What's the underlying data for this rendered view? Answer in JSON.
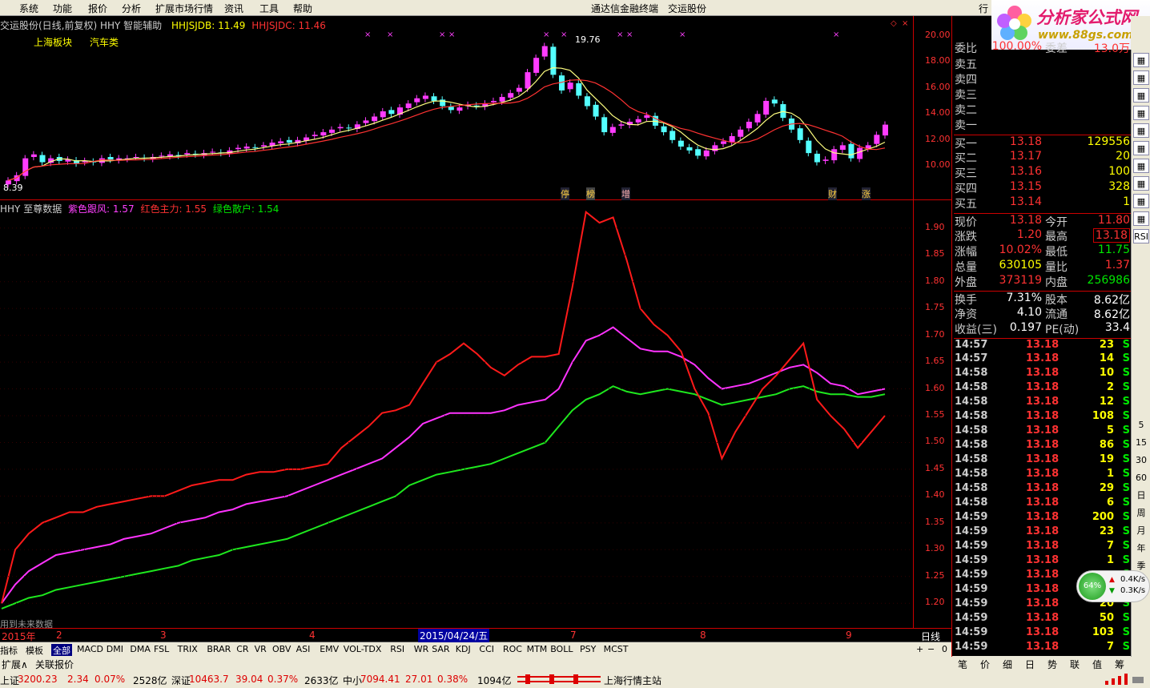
{
  "menu": {
    "items": [
      "系统",
      "功能",
      "报价",
      "分析",
      "扩展市场行情",
      "资讯",
      "工具",
      "帮助"
    ],
    "center1": "通达信金融终端",
    "center2": "交运股份",
    "right_stub": "行"
  },
  "logo": {
    "line1": "分析家公式网",
    "line2": "www.88gs.com"
  },
  "kline": {
    "header_name": "交运股份(日线,前复权) HHY 智能辅助",
    "hhsjdb": "HHJSJDB: 11.49",
    "hhsjdc": "HHJSJDC: 11.46",
    "tag1": "上海板块",
    "tag2": "汽车类",
    "high_label": "19.76",
    "low_label": "8.39",
    "markers": [
      "停",
      "榜",
      "增",
      "财",
      "涨"
    ],
    "yaxis": [
      "20.00",
      "18.00",
      "16.00",
      "14.00",
      "12.00",
      "10.00"
    ],
    "candles": [
      8.9,
      9.3,
      10.6,
      10.9,
      10.3,
      10.6,
      10.4,
      10.5,
      10.2,
      10.4,
      10.3,
      10.6,
      10.5,
      10.6,
      10.6,
      10.7,
      10.6,
      10.7,
      10.8,
      10.9,
      10.8,
      11.0,
      10.9,
      11.0,
      11.1,
      11.0,
      11.2,
      11.4,
      11.5,
      11.4,
      11.6,
      11.8,
      11.9,
      11.8,
      12.0,
      12.2,
      12.4,
      12.6,
      12.8,
      13.0,
      12.9,
      13.2,
      13.5,
      13.8,
      14.2,
      14.0,
      14.5,
      14.8,
      15.2,
      15.4,
      15.0,
      14.6,
      14.3,
      14.5,
      14.7,
      14.6,
      14.8,
      15.0,
      15.3,
      15.6,
      16.0,
      17.2,
      18.3,
      19.2,
      17.0,
      15.8,
      16.4,
      15.4,
      14.6,
      13.8,
      12.6,
      13.0,
      13.2,
      13.4,
      13.6,
      13.9,
      13.1,
      12.6,
      12.0,
      11.5,
      11.2,
      10.8,
      11.2,
      11.6,
      11.9,
      12.3,
      12.8,
      13.4,
      14.0,
      15.0,
      14.8,
      13.7,
      12.8,
      12.0,
      11.0,
      10.3,
      10.5,
      11.3,
      11.6,
      10.6,
      11.4,
      11.6,
      12.4,
      13.18
    ]
  },
  "indicator": {
    "title": "HHY 至尊数据",
    "s1": "紫色跟风: 1.57",
    "s2": "红色主力: 1.55",
    "s3": "绿色散户: 1.54",
    "note": "用到未来数据",
    "yaxis": [
      "1.90",
      "1.85",
      "1.80",
      "1.75",
      "1.70",
      "1.65",
      "1.60",
      "1.55",
      "1.50",
      "1.45",
      "1.40",
      "1.35",
      "1.30",
      "1.25",
      "1.20"
    ],
    "red": [
      1.2,
      1.3,
      1.33,
      1.35,
      1.36,
      1.37,
      1.37,
      1.38,
      1.385,
      1.39,
      1.395,
      1.4,
      1.4,
      1.41,
      1.42,
      1.425,
      1.43,
      1.43,
      1.44,
      1.445,
      1.445,
      1.45,
      1.45,
      1.455,
      1.46,
      1.49,
      1.51,
      1.53,
      1.555,
      1.56,
      1.57,
      1.61,
      1.65,
      1.665,
      1.685,
      1.665,
      1.64,
      1.625,
      1.645,
      1.66,
      1.66,
      1.665,
      1.79,
      1.93,
      1.91,
      1.92,
      1.84,
      1.75,
      1.72,
      1.7,
      1.67,
      1.6,
      1.555,
      1.47,
      1.52,
      1.56,
      1.6,
      1.625,
      1.655,
      1.685,
      1.58,
      1.55,
      1.525,
      1.49,
      1.52,
      1.55
    ],
    "mag": [
      1.2,
      1.235,
      1.26,
      1.275,
      1.29,
      1.295,
      1.3,
      1.305,
      1.31,
      1.32,
      1.325,
      1.33,
      1.34,
      1.35,
      1.355,
      1.36,
      1.37,
      1.375,
      1.385,
      1.39,
      1.395,
      1.4,
      1.41,
      1.42,
      1.43,
      1.44,
      1.45,
      1.46,
      1.47,
      1.49,
      1.51,
      1.535,
      1.545,
      1.555,
      1.555,
      1.555,
      1.555,
      1.56,
      1.57,
      1.575,
      1.58,
      1.6,
      1.65,
      1.69,
      1.7,
      1.715,
      1.695,
      1.675,
      1.67,
      1.67,
      1.66,
      1.645,
      1.62,
      1.6,
      1.605,
      1.61,
      1.62,
      1.63,
      1.64,
      1.645,
      1.63,
      1.61,
      1.605,
      1.59,
      1.595,
      1.6
    ],
    "green": [
      1.19,
      1.2,
      1.21,
      1.215,
      1.225,
      1.23,
      1.235,
      1.24,
      1.245,
      1.25,
      1.255,
      1.26,
      1.265,
      1.27,
      1.28,
      1.285,
      1.29,
      1.3,
      1.305,
      1.31,
      1.315,
      1.32,
      1.33,
      1.34,
      1.35,
      1.36,
      1.37,
      1.38,
      1.39,
      1.4,
      1.42,
      1.43,
      1.44,
      1.445,
      1.45,
      1.455,
      1.46,
      1.47,
      1.48,
      1.49,
      1.5,
      1.53,
      1.56,
      1.58,
      1.59,
      1.605,
      1.595,
      1.59,
      1.595,
      1.6,
      1.595,
      1.59,
      1.58,
      1.57,
      1.575,
      1.58,
      1.585,
      1.59,
      1.6,
      1.605,
      1.595,
      1.59,
      1.59,
      1.585,
      1.585,
      1.59
    ]
  },
  "xaxis": {
    "year": "2015年",
    "labels": [
      "2",
      "3",
      "4",
      "7",
      "8",
      "9"
    ],
    "date": "2015/04/24/五",
    "period": "日线"
  },
  "quote": {
    "weibi": "委比",
    "weibi_v": "100.00%",
    "weicha": "委差",
    "weicha_v": "13.0万",
    "sell": [
      [
        "卖五",
        ""
      ],
      [
        "卖四",
        ""
      ],
      [
        "卖三",
        ""
      ],
      [
        "卖二",
        ""
      ],
      [
        "卖一",
        ""
      ]
    ],
    "buy": [
      [
        "买一",
        "13.18",
        "129556"
      ],
      [
        "买二",
        "13.17",
        "20"
      ],
      [
        "买三",
        "13.16",
        "100"
      ],
      [
        "买四",
        "13.15",
        "328"
      ],
      [
        "买五",
        "13.14",
        "1"
      ]
    ],
    "stats": [
      [
        "现价",
        "13.18",
        "今开",
        "11.80"
      ],
      [
        "涨跌",
        "1.20",
        "最高",
        "13.18"
      ],
      [
        "涨幅",
        "10.02%",
        "最低",
        "11.75"
      ],
      [
        "总量",
        "630105",
        "量比",
        "1.37"
      ],
      [
        "外盘",
        "373119",
        "内盘",
        "256986"
      ]
    ],
    "stats2": [
      [
        "换手",
        "7.31%",
        "股本",
        "8.62亿"
      ],
      [
        "净资",
        "4.10",
        "流通",
        "8.62亿"
      ],
      [
        "收益(三)",
        "0.197",
        "PE(动)",
        "33.4"
      ]
    ]
  },
  "ticks": [
    [
      "14:57",
      "13.18",
      "23"
    ],
    [
      "14:57",
      "13.18",
      "14"
    ],
    [
      "14:58",
      "13.18",
      "10"
    ],
    [
      "14:58",
      "13.18",
      "2"
    ],
    [
      "14:58",
      "13.18",
      "12"
    ],
    [
      "14:58",
      "13.18",
      "108"
    ],
    [
      "14:58",
      "13.18",
      "5"
    ],
    [
      "14:58",
      "13.18",
      "86"
    ],
    [
      "14:58",
      "13.18",
      "19"
    ],
    [
      "14:58",
      "13.18",
      "1"
    ],
    [
      "14:58",
      "13.18",
      "29"
    ],
    [
      "14:58",
      "13.18",
      "6"
    ],
    [
      "14:59",
      "13.18",
      "200"
    ],
    [
      "14:59",
      "13.18",
      "23"
    ],
    [
      "14:59",
      "13.18",
      "7"
    ],
    [
      "14:59",
      "13.18",
      "1"
    ],
    [
      "14:59",
      "13.18",
      ""
    ],
    [
      "14:59",
      "13.18",
      ""
    ],
    [
      "14:59",
      "13.18",
      "20"
    ],
    [
      "14:59",
      "13.18",
      "50"
    ],
    [
      "14:59",
      "13.18",
      "103"
    ],
    [
      "14:59",
      "13.18",
      "7"
    ]
  ],
  "tick_flag": "S",
  "rtool": [
    "5",
    "15",
    "30",
    "60",
    "日",
    "周",
    "月",
    "年",
    "季"
  ],
  "net": {
    "pct": "64%",
    "up": "0.4K/s",
    "down": "0.3K/s"
  },
  "tabs": [
    "指标",
    "模板",
    "全部",
    "MACD",
    "DMI",
    "DMA",
    "FSL",
    "TRIX",
    "BRAR",
    "CR",
    "VR",
    "OBV",
    "ASI",
    "EMV",
    "VOL-TDX",
    "RSI",
    "WR",
    "SAR",
    "KDJ",
    "CCI",
    "ROC",
    "MTM",
    "BOLL",
    "PSY",
    "MCST"
  ],
  "tabs2": [
    "扩展∧",
    "关联报价"
  ],
  "qtabs": [
    "笔",
    "价",
    "细",
    "日",
    "势",
    "联",
    "值",
    "筹"
  ],
  "status": {
    "sh": "上证",
    "sh_v": "3200.23",
    "sh_c": "2.34",
    "sh_p": "0.07%",
    "sh_a": "2528亿",
    "sz": "深证",
    "sz_v": "10463.7",
    "sz_c": "39.04",
    "sz_p": "0.37%",
    "sz_a": "2633亿",
    "zx": "中小",
    "zx_v": "7094.41",
    "zx_c": "27.01",
    "zx_p": "0.38%",
    "zx_a": "1094亿",
    "station": "上海行情主站"
  }
}
